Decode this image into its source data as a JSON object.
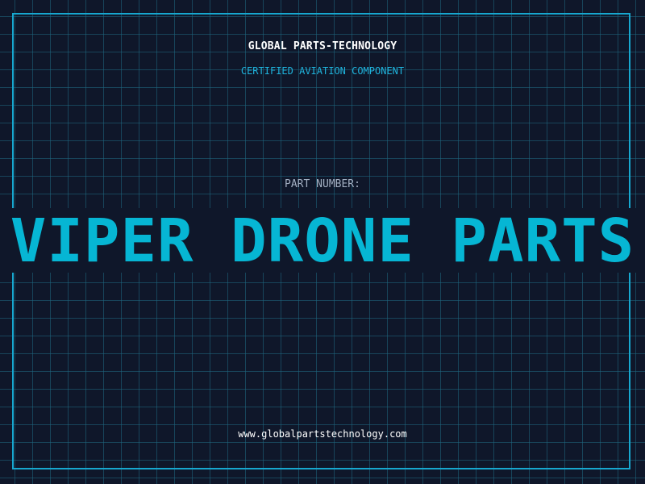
{
  "header": {
    "company": "GLOBAL PARTS-TECHNOLOGY",
    "tagline": "CERTIFIED AVIATION COMPONENT"
  },
  "part": {
    "label": "PART NUMBER:",
    "name": "VIPER DRONE PARTS"
  },
  "footer": {
    "website": "www.globalpartstechnology.com"
  },
  "colors": {
    "background": "#0f172a",
    "grid": "#1e6982",
    "frame": "#17a7cf",
    "accent": "#06b6d4",
    "tagline": "#1fb3dc",
    "label": "#a3afc2",
    "text": "#ffffff"
  }
}
